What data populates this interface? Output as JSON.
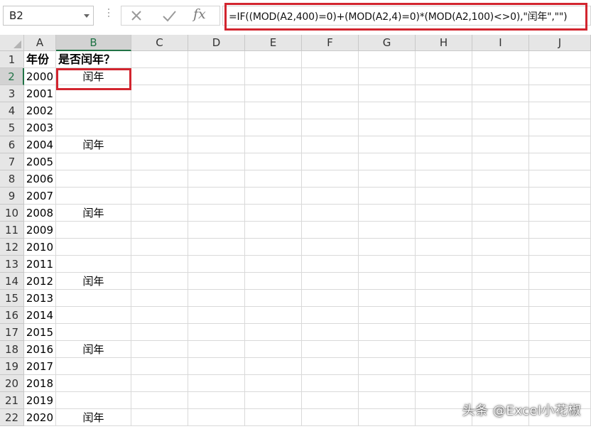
{
  "formula_bar": {
    "name_box": "B2",
    "fx_label": "fx",
    "formula": "=IF((MOD(A2,400)=0)+(MOD(A2,4)=0)*(MOD(A2,100)<>0),\"闰年\",\"\")"
  },
  "columns": [
    "A",
    "B",
    "C",
    "D",
    "E",
    "F",
    "G",
    "H",
    "I",
    "J"
  ],
  "selected_cell": "B2",
  "rows": [
    {
      "num": "1",
      "a": "年份",
      "b": "是否闰年？"
    },
    {
      "num": "2",
      "a": "2000",
      "b": "闰年"
    },
    {
      "num": "3",
      "a": "2001",
      "b": ""
    },
    {
      "num": "4",
      "a": "2002",
      "b": ""
    },
    {
      "num": "5",
      "a": "2003",
      "b": ""
    },
    {
      "num": "6",
      "a": "2004",
      "b": "闰年"
    },
    {
      "num": "7",
      "a": "2005",
      "b": ""
    },
    {
      "num": "8",
      "a": "2006",
      "b": ""
    },
    {
      "num": "9",
      "a": "2007",
      "b": ""
    },
    {
      "num": "10",
      "a": "2008",
      "b": "闰年"
    },
    {
      "num": "11",
      "a": "2009",
      "b": ""
    },
    {
      "num": "12",
      "a": "2010",
      "b": ""
    },
    {
      "num": "13",
      "a": "2011",
      "b": ""
    },
    {
      "num": "14",
      "a": "2012",
      "b": "闰年"
    },
    {
      "num": "15",
      "a": "2013",
      "b": ""
    },
    {
      "num": "16",
      "a": "2014",
      "b": ""
    },
    {
      "num": "17",
      "a": "2015",
      "b": ""
    },
    {
      "num": "18",
      "a": "2016",
      "b": "闰年"
    },
    {
      "num": "19",
      "a": "2017",
      "b": ""
    },
    {
      "num": "20",
      "a": "2018",
      "b": ""
    },
    {
      "num": "21",
      "a": "2019",
      "b": ""
    },
    {
      "num": "22",
      "a": "2020",
      "b": "闰年"
    }
  ],
  "watermark": "头条 @Excel小花椒",
  "colors": {
    "highlight": "#d2252f",
    "selection": "#217346"
  }
}
